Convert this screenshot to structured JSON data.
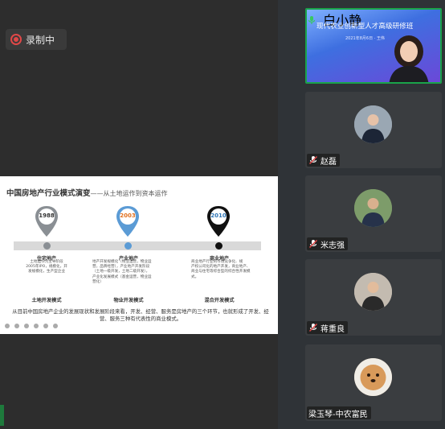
{
  "recording": {
    "label": "录制中"
  },
  "slide": {
    "title": "中国房地产行业模式演变",
    "subtitle": "——从土地运作到资本运作",
    "timeline": [
      {
        "year": "1988",
        "color": "#8a8f94",
        "stage": "住宅地产",
        "mode": "土地开发模式",
        "desc": [
          "土地运作为主导阶段",
          "2005年IPO，规模化，开",
          "发规模化，生产型企业"
        ]
      },
      {
        "year": "2003",
        "color": "#5b9bd5",
        "stage": "产业地产",
        "mode": "物业开发模式",
        "desc": [
          "地产开发规模化（物业运营，物业运",
          "营，品牌经营），产业地产开发阶段",
          "（土地一级开发，土地二级开发），",
          "产业化发展模式（基金运营，物业运",
          "营化）"
        ]
      },
      {
        "year": "2010",
        "color": "#111111",
        "stage": "商业地产",
        "mode": "混合开发模式",
        "desc": [
          "商业地产行业的市场竞争化、规",
          "产权公司化的地产开发，商业地产、",
          "商业与住宅等综合型的综合性开发模",
          "式。"
        ]
      }
    ],
    "summary": "从目前中国房地产企业的发展现状和发展阶段来看，开发、经营、服务是房地产的三个环节，也就形成了开发、经营、服务三种有代表性的商业模式。"
  },
  "participants": [
    {
      "name": "白小静",
      "video_title": "现代农业创新型人才高级研修班",
      "video_sub": "2021年8月6日 · 王伟",
      "muted": false
    },
    {
      "name": "赵磊",
      "muted": true
    },
    {
      "name": "米志强",
      "muted": true
    },
    {
      "name": "蒋重良",
      "muted": true
    },
    {
      "name": "梁玉琴-中农富民",
      "muted": false
    }
  ],
  "colors": {
    "accent_green": "#1aa34a",
    "mute_red": "#e04848",
    "panel_bg": "#2f3337"
  }
}
